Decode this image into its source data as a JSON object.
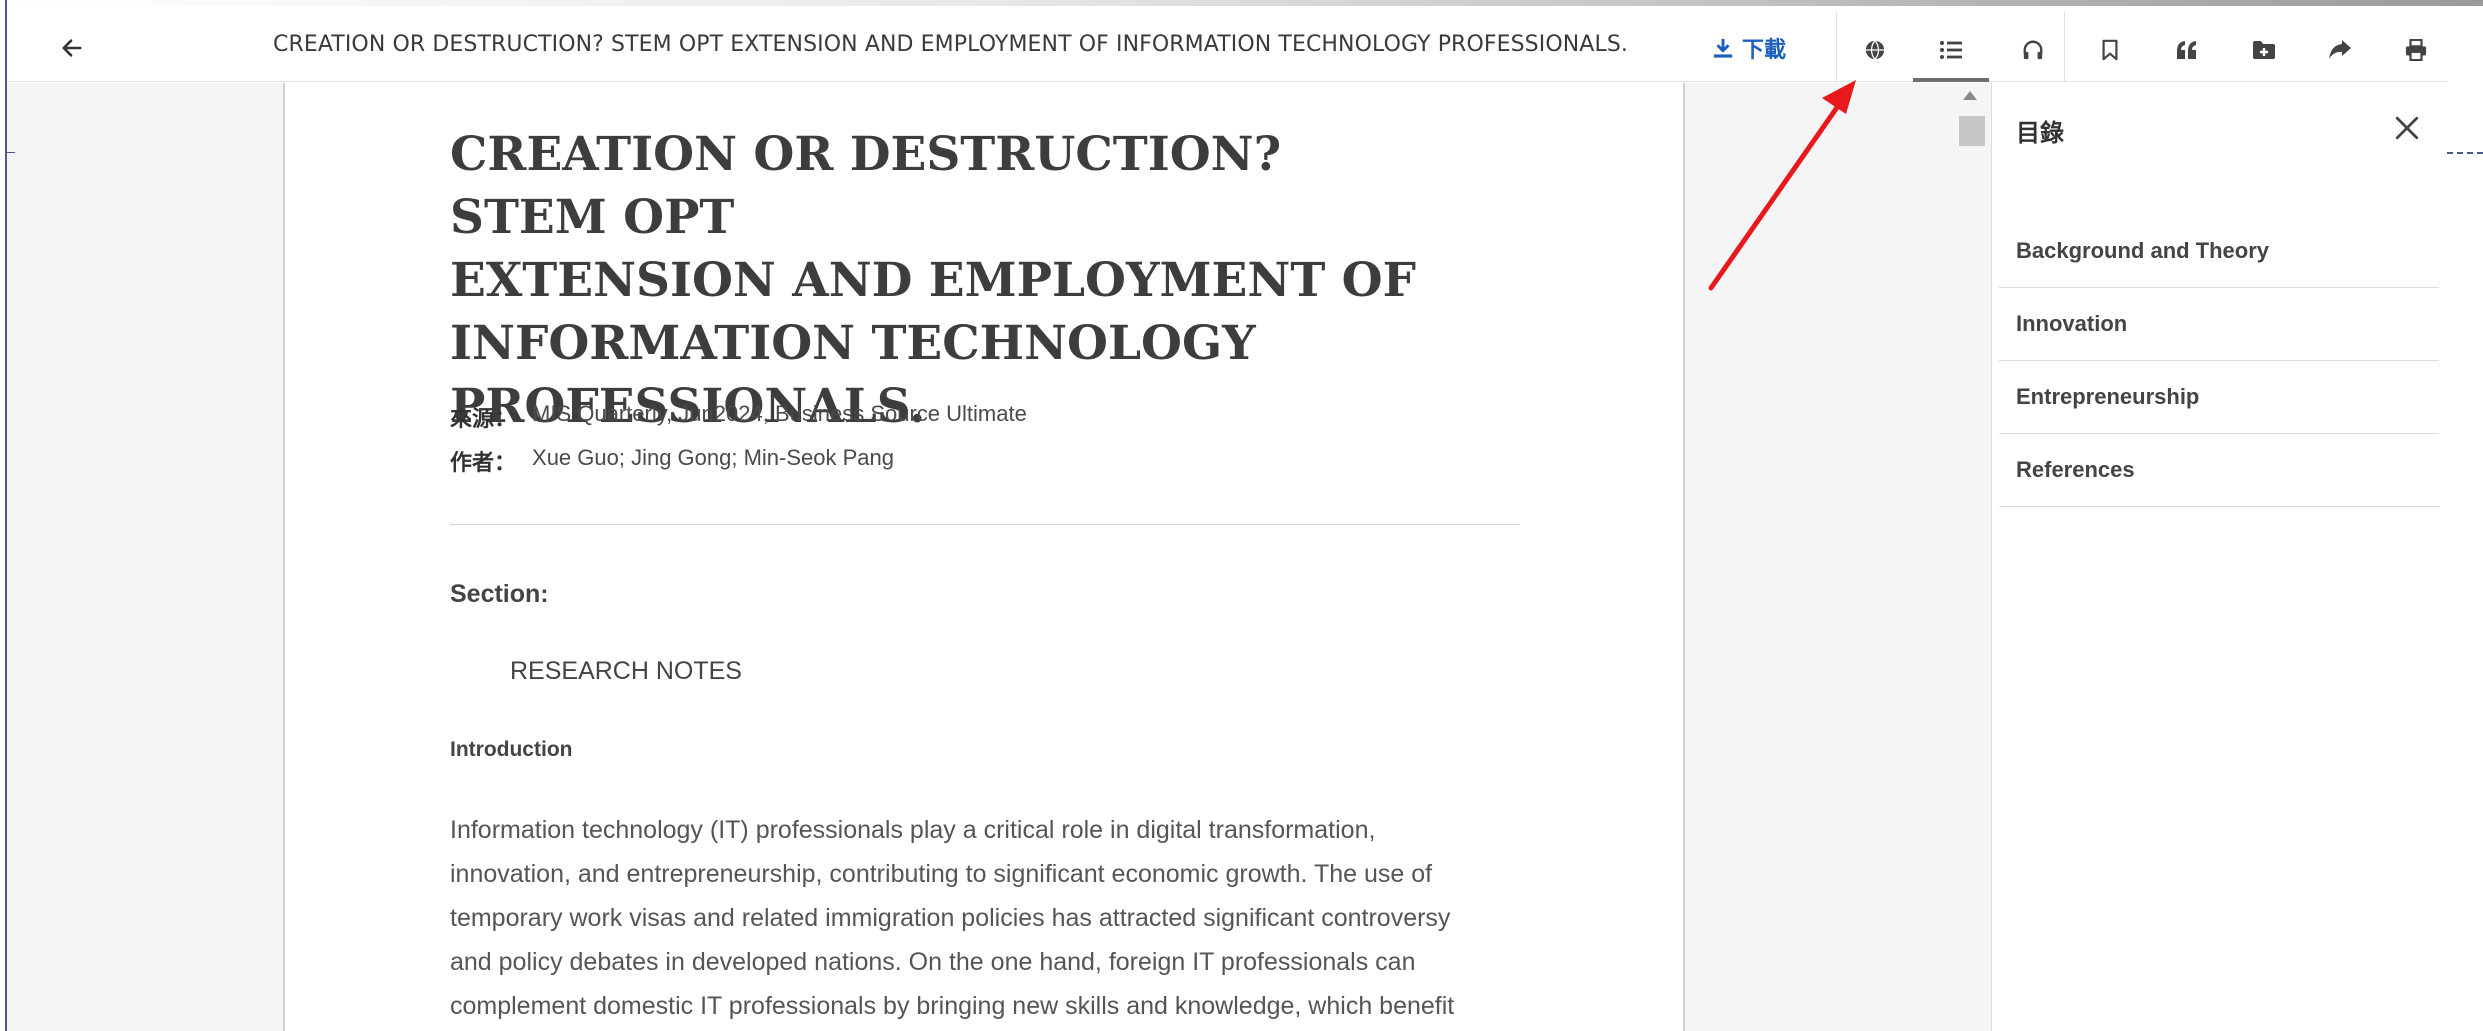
{
  "toolbar": {
    "document_title": "CREATION OR DESTRUCTION? STEM OPT EXTENSION AND EMPLOYMENT OF INFORMATION TECHNOLOGY PROFESSIONALS.",
    "download_label": "下載",
    "icons": [
      "back-arrow-icon",
      "download-icon",
      "globe-icon",
      "list-icon",
      "headphones-icon",
      "bookmark-icon",
      "quote-icon",
      "folder-add-icon",
      "share-icon",
      "print-icon"
    ],
    "active_icon": "list-icon"
  },
  "article": {
    "title_lines": [
      "CREATION OR DESTRUCTION? STEM OPT",
      "EXTENSION AND EMPLOYMENT OF",
      "INFORMATION TECHNOLOGY",
      "PROFESSIONALS."
    ],
    "source_label": "來源：",
    "source_value": "MIS Quarterly, Jun2024, Business Source Ultimate",
    "author_label": "作者：",
    "author_value": "Xue Guo; Jing Gong; Min-Seok Pang",
    "section_label": "Section:",
    "section_value": "RESEARCH NOTES",
    "intro_label": "Introduction",
    "body_lines": [
      "Information technology (IT) professionals play a critical role in digital transformation,",
      "innovation, and entrepreneurship, contributing to significant economic growth. The use of",
      "temporary work visas and related immigration policies has attracted significant controversy",
      "and policy debates in developed nations. On the one hand, foreign IT professionals can",
      "complement domestic IT professionals by bringing new skills and knowledge, which benefit"
    ]
  },
  "toc": {
    "title": "目錄",
    "items": [
      {
        "label": "Background and Theory"
      },
      {
        "label": "Innovation"
      },
      {
        "label": "Entrepreneurship"
      },
      {
        "label": "References"
      }
    ]
  },
  "colors": {
    "accent_blue": "#1d5fbf",
    "annotation_red": "#e8191c"
  }
}
